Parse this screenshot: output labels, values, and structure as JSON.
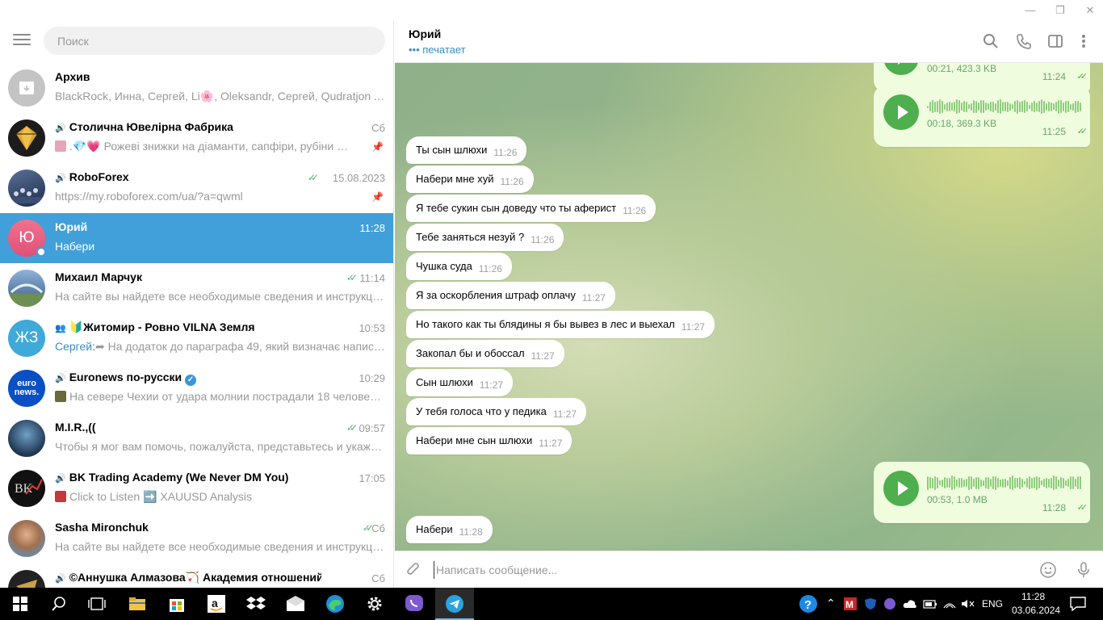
{
  "window": {
    "title": ""
  },
  "sidebar": {
    "search_placeholder": "Поиск",
    "chats": [
      {
        "name": "Архив",
        "time": "",
        "preview": "BlackRock, Инна, Сергей, Li🌸, Oleksandr, Сергей, Qudratjon Ahm...",
        "avatar_text": "",
        "avatar_color": "#c4c4c4"
      },
      {
        "name": "Столична Ювелірна Фабрика",
        "time": "Сб",
        "preview": ".💎💗 Рожеві знижки на діаманти, сапфіри, рубіни ✔️ Б...",
        "avatar_text": "",
        "avatar_color": "#1c1c1c",
        "pinned": true
      },
      {
        "name": "RoboForex",
        "time": "15.08.2023",
        "preview": "https://my.roboforex.com/ua/?a=qwml",
        "avatar_text": "",
        "avatar_color": "#2a3a5a",
        "pinned": true,
        "read": true
      },
      {
        "name": "Юрий",
        "time": "11:28",
        "preview": "Набери",
        "avatar_text": "Ю",
        "avatar_color": "#e9587a",
        "active": true
      },
      {
        "name": "Михаил Марчук",
        "time": "11:14",
        "preview": "На сайте вы найдете все необходимые сведения и инструкции д...",
        "avatar_text": "",
        "avatar_color": "#6a8fb5",
        "read": true
      },
      {
        "name": "🔰Житомир - Ровно VILNA Земля",
        "time": "10:53",
        "sender": "Сергей:",
        "preview": "➦ На додаток до параграфа 49, який визначає написанн...",
        "avatar_text": "ЖЗ",
        "avatar_color": "#3fa9d8"
      },
      {
        "name": "Euronews по-русски",
        "time": "10:29",
        "preview": "На севере Чехии от удара молнии пострадали 18 человек htt...",
        "avatar_text": "euro news.",
        "avatar_color": "#0a4fc4"
      },
      {
        "name": "M.I.R.,((",
        "time": "09:57",
        "preview": "Чтобы я мог вам помочь, пожалуйста, представьтесь и укажите...",
        "avatar_text": "",
        "avatar_color": "#1f3550",
        "read": true
      },
      {
        "name": "BK Trading Academy (We Never DM You)",
        "time": "17:05",
        "preview": "Click to Listen ➡️ XAUUSD Analysis",
        "avatar_text": "BK",
        "avatar_color": "#111111"
      },
      {
        "name": "Sasha Mironchuk",
        "time": "Сб",
        "preview": "На сайте вы найдете все необходимые сведения и инструкции д...",
        "avatar_text": "",
        "avatar_color": "#a07050",
        "read": true
      },
      {
        "name": "©Аннушка Алмазова🏹 Академия отношений",
        "time": "Сб",
        "preview": "",
        "avatar_text": "",
        "avatar_color": "#222222"
      }
    ]
  },
  "chat": {
    "name": "Юрий",
    "status": "печатает",
    "composer_placeholder": "Написать сообщение...",
    "voice_messages": [
      {
        "meta": "00:21, 423.3 KB",
        "time": "11:24"
      },
      {
        "meta": "00:18, 369.3 KB",
        "time": "11:25"
      },
      {
        "meta": "00:53, 1.0 MB",
        "time": "11:28"
      }
    ],
    "messages": [
      {
        "text": "Ты сын шлюхи",
        "time": "11:26"
      },
      {
        "text": "Набери мне хуй",
        "time": "11:26"
      },
      {
        "text": "Я тебе сукин сын доведу что ты аферист",
        "time": "11:26"
      },
      {
        "text": "Тебе заняться незуй ?",
        "time": "11:26"
      },
      {
        "text": "Чушка суда",
        "time": "11:26"
      },
      {
        "text": "Я за оскорбления штраф оплачу",
        "time": "11:27"
      },
      {
        "text": "Но такого как ты блядины я бы вывез в лес и выехал",
        "time": "11:27"
      },
      {
        "text": "Закопал бы и обоссал",
        "time": "11:27"
      },
      {
        "text": "Сын шлюхи",
        "time": "11:27"
      },
      {
        "text": "У тебя голоса что у педика",
        "time": "11:27"
      },
      {
        "text": "Набери мне сын шлюхи",
        "time": "11:27"
      },
      {
        "text": "Набери",
        "time": "11:28"
      }
    ]
  },
  "taskbar": {
    "language": "ENG",
    "time": "11:28",
    "date": "03.06.2024"
  },
  "colors": {
    "accent": "#419fd9",
    "read_check": "#4dbb61",
    "voice_bubble": "#effdde",
    "play_button": "#4fae4e"
  }
}
